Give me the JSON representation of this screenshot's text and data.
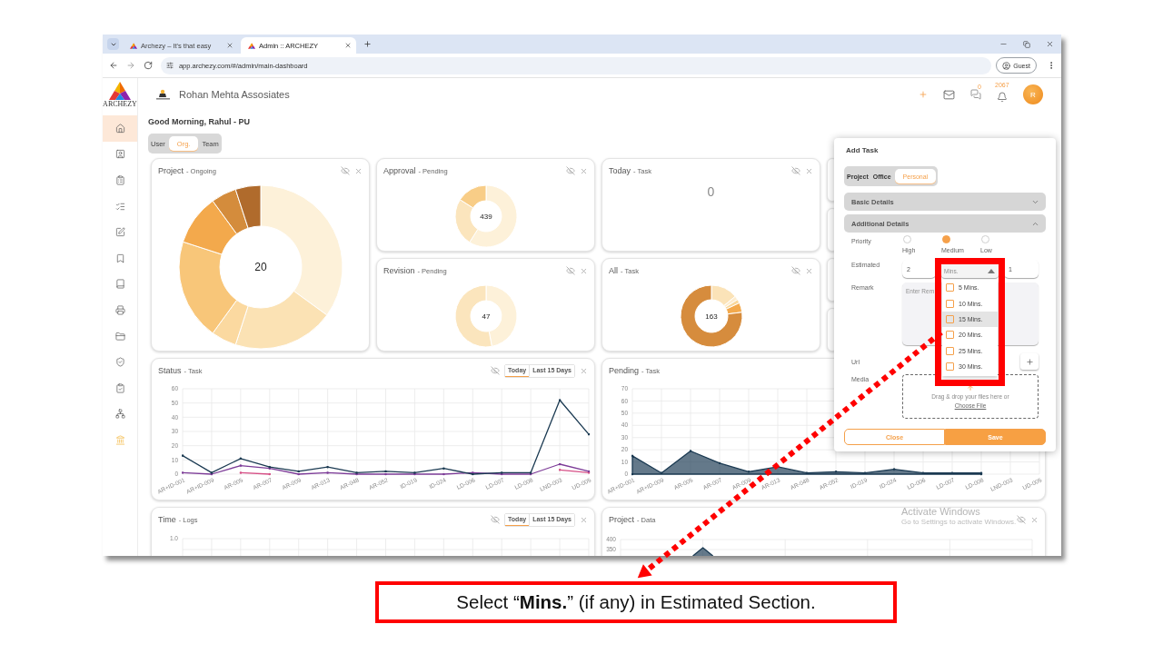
{
  "browser": {
    "tabs": [
      {
        "title": "Archezy – It's that easy",
        "selected": false
      },
      {
        "title": "Admin :: ARCHEZY",
        "selected": true
      }
    ],
    "url": "app.archezy.com/#/admin/main-dashboard",
    "profile": "Guest"
  },
  "sidebar": {
    "logo_text": "ARCHEZY",
    "items": [
      {
        "selected": true
      },
      {
        "selected": false
      },
      {
        "selected": false
      },
      {
        "selected": false
      },
      {
        "selected": false
      },
      {
        "selected": false
      },
      {
        "selected": false
      },
      {
        "selected": false
      },
      {
        "selected": false
      },
      {
        "selected": false
      },
      {
        "selected": false
      },
      {
        "selected": false
      },
      {
        "selected": false
      }
    ]
  },
  "header": {
    "company": "Rohan Mehta Assosiates",
    "chat_count": "0",
    "notification_count": "2067",
    "avatar": "R"
  },
  "greeting": "Good Morning, Rahul - PU",
  "scope_tabs": [
    {
      "label": "User",
      "selected": false
    },
    {
      "label": "Org.",
      "selected": true
    },
    {
      "label": "Team",
      "selected": false
    }
  ],
  "cards": [
    {
      "kind": "donut",
      "title": "Project",
      "subtitle": "- Ongoing",
      "controls": true,
      "total": "20",
      "chart_data": {
        "type": "donut",
        "values": [
          35,
          20,
          5,
          20,
          10,
          5,
          5
        ]
      }
    },
    {
      "kind": "donut",
      "title": "Approval",
      "subtitle": "- Pending",
      "controls": true,
      "total": "439",
      "chart_data": {
        "type": "donut",
        "values": [
          59,
          25,
          16
        ]
      }
    },
    {
      "kind": "count",
      "title": "Today",
      "subtitle": "- Task",
      "controls": true,
      "count": "0"
    },
    {
      "kind": "blank"
    },
    {
      "kind": "blank"
    },
    {
      "kind": "donut",
      "title": "Revision",
      "subtitle": "- Pending",
      "controls": true,
      "total": "47",
      "chart_data": {
        "type": "donut",
        "values": [
          47,
          53
        ]
      }
    },
    {
      "kind": "donut",
      "title": "All",
      "subtitle": "- Task",
      "controls": true,
      "total": "163",
      "chart_data": {
        "type": "donut",
        "values": [
          14,
          2,
          2,
          5,
          77
        ]
      }
    },
    {
      "kind": "blank"
    },
    {
      "kind": "blank"
    },
    {
      "kind": "chart",
      "title": "Status",
      "subtitle": "- Task",
      "controls": true,
      "filters": [
        {
          "label": "Today",
          "selected": true
        },
        {
          "label": "Last 15 Days",
          "selected": false
        }
      ],
      "chart_data": {
        "type": "line",
        "grid": true,
        "categories": [
          "AR+ID-001",
          "AR+ID-009",
          "AR-005",
          "AR-007",
          "AR-009",
          "AR-013",
          "AR-048",
          "AR-052",
          "ID-019",
          "ID-024",
          "LD-006",
          "LD-007",
          "LD-008",
          "LND-003",
          "UD-005"
        ],
        "ylim": [
          0,
          60
        ],
        "yticks": [
          0,
          10,
          20,
          30,
          40,
          50,
          60
        ],
        "series": [
          {
            "color": "#d64f86",
            "values": [
              null,
              null,
              1,
              0,
              null,
              null,
              null,
              null,
              null,
              null,
              null,
              null,
              null,
              3,
              1
            ]
          },
          {
            "color": "#7d3c98",
            "values": [
              1,
              0,
              6,
              4,
              0,
              1,
              0,
              0,
              0,
              0,
              1,
              0,
              0,
              7,
              2
            ]
          },
          {
            "color": "#1b3a52",
            "values": [
              13,
              1,
              11,
              5,
              2,
              5,
              1,
              2,
              1,
              4,
              0,
              1,
              1,
              52,
              28
            ]
          }
        ]
      }
    },
    {
      "kind": "chart",
      "title": "Pending",
      "subtitle": "- Task",
      "controls": false,
      "chart_data": {
        "type": "area",
        "grid": true,
        "categories": [
          "AR+ID-001",
          "AR+ID-009",
          "AR-005",
          "AR-007",
          "AR-009",
          "AR-013",
          "AR-048",
          "AR-052",
          "ID-019",
          "ID-024",
          "LD-006",
          "LD-007",
          "LD-008",
          "LND-003",
          "UD-005"
        ],
        "ylim": [
          0,
          70
        ],
        "yticks": [
          0,
          10,
          20,
          30,
          40,
          50,
          60,
          70
        ],
        "series": [
          {
            "color": "#1b3a52",
            "values": [
              15,
              1,
              19,
              9,
              2,
              6,
              1,
              2,
              1,
              4,
              1,
              1,
              1,
              null,
              null
            ]
          }
        ]
      }
    },
    {
      "kind": "empty_chart",
      "title": "Time",
      "subtitle": "- Logs",
      "controls": true,
      "filters": [
        {
          "label": "Today",
          "selected": true
        },
        {
          "label": "Last 15 Days",
          "selected": false
        }
      ],
      "axis_labels": [
        "1.0"
      ]
    },
    {
      "kind": "sketch",
      "title": "Project",
      "subtitle": "- Data",
      "controls": true,
      "axis_labels": [
        "400",
        "350"
      ]
    }
  ],
  "add_task": {
    "title": "Add Task",
    "types": [
      {
        "label": "Project",
        "selected": false
      },
      {
        "label": "Office",
        "selected": false
      },
      {
        "label": "Personal",
        "selected": true
      }
    ],
    "sections": [
      {
        "title": "Basic Details",
        "expanded": false
      },
      {
        "title": "Additional Details",
        "expanded": true
      }
    ],
    "priority": {
      "label": "Priority",
      "options": [
        {
          "label": "High",
          "selected": false
        },
        {
          "label": "Medium",
          "selected": true
        },
        {
          "label": "Low",
          "selected": false
        }
      ]
    },
    "estimated": {
      "label": "Estimated",
      "value": "2",
      "placeholder": "Mins.",
      "expanded": true,
      "extra_value": "1",
      "units": [
        {
          "label": "5 Mins.",
          "checked": false,
          "highlighted": false
        },
        {
          "label": "10 Mins.",
          "checked": false,
          "highlighted": false
        },
        {
          "label": "15 Mins.",
          "checked": false,
          "highlighted": true
        },
        {
          "label": "20 Mins.",
          "checked": false,
          "highlighted": false
        },
        {
          "label": "25 Mins.",
          "checked": false,
          "highlighted": false
        },
        {
          "label": "30 Mins.",
          "checked": false,
          "highlighted": false
        }
      ]
    },
    "remark": {
      "label": "Remark",
      "placeholder": "Enter Rem"
    },
    "url": {
      "label": "Url"
    },
    "media": {
      "label": "Media",
      "hint": "Drag & drop your files here or",
      "link": "Choose File"
    },
    "buttons": [
      {
        "label": "Close",
        "kind": "outline"
      },
      {
        "label": "Save",
        "kind": "primary"
      }
    ]
  },
  "os_notice": {
    "title": "Activate Windows",
    "text": "Go to Settings to activate Windows."
  },
  "caption": "Select “**Mins.**” (if any) in Estimated Section."
}
